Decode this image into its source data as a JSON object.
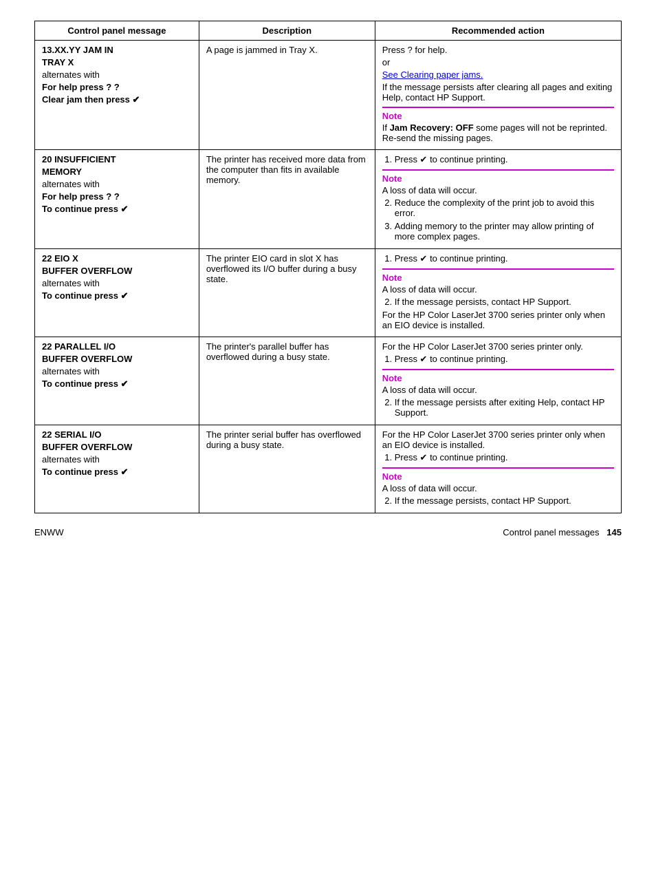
{
  "table": {
    "headers": [
      "Control panel message",
      "Description",
      "Recommended action"
    ],
    "rows": [
      {
        "id": "row-jam",
        "col1": {
          "lines": [
            {
              "text": "13.XX.YY JAM IN",
              "bold": true
            },
            {
              "text": "TRAY X",
              "bold": true
            },
            {
              "text": "alternates with",
              "bold": false
            },
            {
              "text": "For help press ? ?",
              "bold": true
            },
            {
              "text": "Clear jam then press ✔",
              "bold": true
            }
          ]
        },
        "col2": "A page is jammed in Tray X.",
        "col3_items": [
          {
            "type": "text",
            "content": "Press ? for help."
          },
          {
            "type": "text",
            "content": "or"
          },
          {
            "type": "link",
            "content": "See Clearing paper jams."
          },
          {
            "type": "text",
            "content": "If the message persists after clearing all pages and exiting Help, contact HP Support."
          },
          {
            "type": "note_divider"
          },
          {
            "type": "note_label",
            "content": "Note"
          },
          {
            "type": "bold_text",
            "prefix": "If ",
            "bold": "Jam Recovery: OFF",
            "suffix": " some pages will not be reprinted. Re-send the missing pages."
          }
        ]
      },
      {
        "id": "row-memory",
        "col1": {
          "lines": [
            {
              "text": "20 INSUFFICIENT",
              "bold": true
            },
            {
              "text": "MEMORY",
              "bold": true
            },
            {
              "text": "alternates with",
              "bold": false
            },
            {
              "text": "For help press ? ?",
              "bold": true
            },
            {
              "text": "To continue press ✔",
              "bold": true
            }
          ]
        },
        "col2": "The printer has received more data from the computer than fits in available memory.",
        "col3_items": [
          {
            "type": "ordered",
            "items": [
              {
                "text": "Press ✔ to continue printing.",
                "note_after": true,
                "note_text": "A loss of data will occur."
              },
              {
                "text": "Reduce the complexity of the print job to avoid this error."
              },
              {
                "text": "Adding memory to the printer may allow printing of more complex pages."
              }
            ]
          }
        ]
      },
      {
        "id": "row-eio",
        "col1": {
          "lines": [
            {
              "text": "22 EIO X",
              "bold": true
            },
            {
              "text": "BUFFER OVERFLOW",
              "bold": true
            },
            {
              "text": "alternates with",
              "bold": false
            },
            {
              "text": "To continue press ✔",
              "bold": true
            }
          ]
        },
        "col2": "The printer EIO card in slot X has overflowed its I/O buffer during a busy state.",
        "col3_items": [
          {
            "type": "ordered",
            "items": [
              {
                "text": "Press ✔ to continue printing.",
                "note_after": true,
                "note_text": "A loss of data will occur."
              },
              {
                "text": "If the message persists, contact HP Support."
              }
            ]
          },
          {
            "type": "text",
            "content": "For the HP Color LaserJet 3700 series printer only when an EIO device is installed."
          }
        ]
      },
      {
        "id": "row-parallel",
        "col1": {
          "lines": [
            {
              "text": "22 PARALLEL I/O",
              "bold": true
            },
            {
              "text": "BUFFER OVERFLOW",
              "bold": true
            },
            {
              "text": "alternates with",
              "bold": false
            },
            {
              "text": "To continue press ✔",
              "bold": true
            }
          ]
        },
        "col2": "The printer's parallel buffer has overflowed during a busy state.",
        "col3_items": [
          {
            "type": "text",
            "content": "For the HP Color LaserJet 3700 series printer only."
          },
          {
            "type": "ordered",
            "items": [
              {
                "text": "Press ✔ to continue printing.",
                "note_after": true,
                "note_text": "A loss of data will occur."
              },
              {
                "text": "If the message persists after exiting Help, contact HP Support."
              }
            ]
          }
        ]
      },
      {
        "id": "row-serial",
        "col1": {
          "lines": [
            {
              "text": "22 SERIAL I/O",
              "bold": true
            },
            {
              "text": "BUFFER OVERFLOW",
              "bold": true
            },
            {
              "text": "alternates with",
              "bold": false
            },
            {
              "text": "To continue press ✔",
              "bold": true
            }
          ]
        },
        "col2": "The printer serial buffer has overflowed during a busy state.",
        "col3_items": [
          {
            "type": "text",
            "content": "For the HP Color LaserJet 3700 series printer only when an EIO device is installed."
          },
          {
            "type": "ordered",
            "items": [
              {
                "text": "Press ✔ to continue printing.",
                "note_after": true,
                "note_text": "A loss of data will occur."
              },
              {
                "text": "If the message persists, contact HP Support."
              }
            ]
          }
        ]
      }
    ]
  },
  "footer": {
    "left": "ENWW",
    "right_prefix": "Control panel messages",
    "page": "145"
  }
}
